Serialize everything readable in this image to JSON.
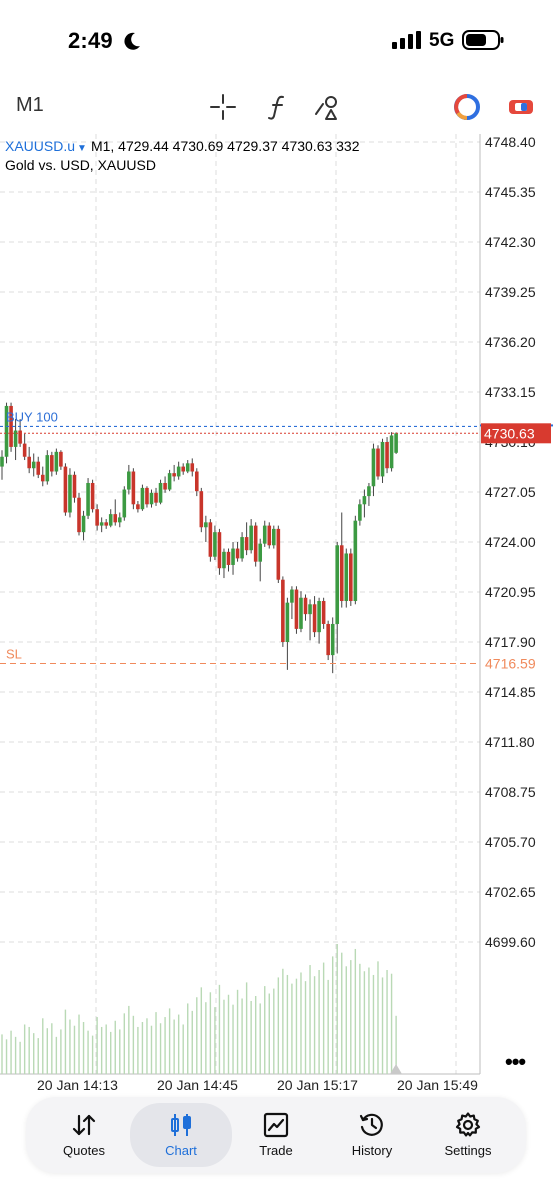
{
  "status_bar": {
    "time": "2:49",
    "network": "5G"
  },
  "toolbar": {
    "timeframe": "M1"
  },
  "chart": {
    "symbol": "XAUUSD.u",
    "ohlc_line": "M1, 4729.44 4730.69 4729.37 4730.63 332",
    "description": "Gold vs. USD, XAUUSD",
    "price_labels": [
      "4748.40",
      "4745.35",
      "4742.30",
      "4739.25",
      "4736.20",
      "4733.15",
      "4730.10",
      "4727.05",
      "4724.00",
      "4720.95",
      "4717.90",
      "4714.85",
      "4711.80",
      "4708.75",
      "4705.70",
      "4702.65",
      "4699.60"
    ],
    "time_labels": [
      "20 Jan 14:13",
      "20 Jan 14:45",
      "20 Jan 15:17",
      "20 Jan 15:49"
    ],
    "current_price": "4730.63",
    "buy_line_label": "BUY 100",
    "sl_label": "SL",
    "sl_price": "4716.59",
    "colors": {
      "bull": "#3c9a42",
      "bear": "#c8352b",
      "current": "#d83a2f",
      "buy": "#2d6fd6",
      "sl": "#f08a5c",
      "grid": "#dcdcdc",
      "volume": "#b9d9b5"
    }
  },
  "chart_data": {
    "type": "candlestick",
    "ylim": [
      4699.6,
      4748.4
    ],
    "candles": [
      [
        4728.6,
        4729.6,
        4727.8,
        4729.2
      ],
      [
        4729.2,
        4732.5,
        4728.8,
        4732.3
      ],
      [
        4732.3,
        4732.5,
        4729.5,
        4729.8
      ],
      [
        4729.8,
        4731.5,
        4729.0,
        4730.8
      ],
      [
        4730.8,
        4731.5,
        4729.8,
        4730.0
      ],
      [
        4730.0,
        4730.6,
        4729.0,
        4729.2
      ],
      [
        4729.2,
        4729.8,
        4728.2,
        4728.5
      ],
      [
        4728.5,
        4729.4,
        4728.0,
        4728.9
      ],
      [
        4728.9,
        4729.2,
        4727.9,
        4728.1
      ],
      [
        4728.1,
        4728.6,
        4727.4,
        4727.7
      ],
      [
        4727.7,
        4729.6,
        4727.5,
        4729.3
      ],
      [
        4729.3,
        4729.5,
        4728.0,
        4728.3
      ],
      [
        4728.3,
        4729.7,
        4728.1,
        4729.5
      ],
      [
        4729.5,
        4729.6,
        4728.4,
        4728.6
      ],
      [
        4728.6,
        4728.8,
        4725.6,
        4725.8
      ],
      [
        4725.8,
        4728.5,
        4725.5,
        4728.1
      ],
      [
        4728.1,
        4728.3,
        4726.4,
        4726.7
      ],
      [
        4726.7,
        4727.0,
        4724.4,
        4724.6
      ],
      [
        4724.6,
        4725.9,
        4724.1,
        4725.6
      ],
      [
        4725.6,
        4727.9,
        4725.4,
        4727.6
      ],
      [
        4727.6,
        4727.8,
        4725.8,
        4726.0
      ],
      [
        4726.0,
        4726.3,
        4724.7,
        4725.0
      ],
      [
        4725.0,
        4725.5,
        4724.6,
        4725.2
      ],
      [
        4725.2,
        4725.4,
        4724.8,
        4725.0
      ],
      [
        4725.0,
        4726.0,
        4724.9,
        4725.7
      ],
      [
        4725.7,
        4726.6,
        4725.0,
        4725.2
      ],
      [
        4725.2,
        4725.8,
        4724.9,
        4725.5
      ],
      [
        4725.5,
        4727.4,
        4725.3,
        4727.2
      ],
      [
        4727.2,
        4728.7,
        4726.9,
        4728.3
      ],
      [
        4728.3,
        4728.5,
        4726.0,
        4726.3
      ],
      [
        4726.3,
        4726.5,
        4725.8,
        4726.0
      ],
      [
        4726.0,
        4727.5,
        4725.9,
        4727.3
      ],
      [
        4727.3,
        4727.4,
        4726.1,
        4726.3
      ],
      [
        4726.3,
        4727.2,
        4726.1,
        4727.0
      ],
      [
        4727.0,
        4727.3,
        4726.2,
        4726.4
      ],
      [
        4726.4,
        4727.8,
        4726.3,
        4727.6
      ],
      [
        4727.6,
        4728.0,
        4727.0,
        4727.2
      ],
      [
        4727.2,
        4728.4,
        4727.1,
        4728.2
      ],
      [
        4728.2,
        4728.7,
        4727.7,
        4728.0
      ],
      [
        4728.0,
        4728.9,
        4727.8,
        4728.6
      ],
      [
        4728.6,
        4728.8,
        4728.1,
        4728.3
      ],
      [
        4728.3,
        4729.0,
        4728.2,
        4728.8
      ],
      [
        4728.8,
        4729.1,
        4728.0,
        4728.3
      ],
      [
        4728.3,
        4728.5,
        4726.8,
        4727.1
      ],
      [
        4727.1,
        4727.3,
        4724.6,
        4724.9
      ],
      [
        4724.9,
        4725.6,
        4724.0,
        4725.2
      ],
      [
        4725.2,
        4725.4,
        4722.8,
        4723.1
      ],
      [
        4723.1,
        4725.0,
        4722.9,
        4724.6
      ],
      [
        4724.6,
        4724.8,
        4722.0,
        4722.4
      ],
      [
        4722.4,
        4723.6,
        4721.8,
        4723.4
      ],
      [
        4723.4,
        4723.6,
        4722.2,
        4722.6
      ],
      [
        4722.6,
        4724.0,
        4722.0,
        4723.6
      ],
      [
        4723.6,
        4724.0,
        4722.8,
        4723.0
      ],
      [
        4723.0,
        4724.6,
        4722.8,
        4724.3
      ],
      [
        4724.3,
        4725.2,
        4723.2,
        4723.5
      ],
      [
        4723.5,
        4725.4,
        4723.3,
        4725.0
      ],
      [
        4725.0,
        4725.2,
        4722.5,
        4722.8
      ],
      [
        4722.8,
        4724.2,
        4721.6,
        4723.9
      ],
      [
        4723.9,
        4725.3,
        4723.7,
        4725.0
      ],
      [
        4725.0,
        4725.2,
        4723.6,
        4723.8
      ],
      [
        4723.8,
        4725.0,
        4723.6,
        4724.8
      ],
      [
        4724.8,
        4725.0,
        4721.5,
        4721.7
      ],
      [
        4721.7,
        4721.9,
        4717.6,
        4717.9
      ],
      [
        4717.9,
        4720.6,
        4716.2,
        4720.3
      ],
      [
        4720.3,
        4721.3,
        4719.3,
        4721.1
      ],
      [
        4721.1,
        4721.3,
        4718.4,
        4718.7
      ],
      [
        4718.7,
        4721.0,
        4718.5,
        4720.6
      ],
      [
        4720.6,
        4720.8,
        4719.2,
        4719.6
      ],
      [
        4719.6,
        4720.5,
        4718.0,
        4720.2
      ],
      [
        4720.2,
        4720.7,
        4718.2,
        4718.5
      ],
      [
        4718.5,
        4720.6,
        4717.8,
        4720.4
      ],
      [
        4720.4,
        4720.6,
        4718.7,
        4719.0
      ],
      [
        4719.0,
        4719.2,
        4716.8,
        4717.1
      ],
      [
        4717.1,
        4719.4,
        4716.0,
        4719.0
      ],
      [
        4719.0,
        4724.0,
        4717.2,
        4723.8
      ],
      [
        4723.8,
        4725.8,
        4720.0,
        4720.4
      ],
      [
        4720.4,
        4723.6,
        4720.0,
        4723.3
      ],
      [
        4723.3,
        4723.6,
        4720.1,
        4720.4
      ],
      [
        4720.4,
        4725.6,
        4720.2,
        4725.3
      ],
      [
        4725.3,
        4726.6,
        4725.0,
        4726.3
      ],
      [
        4726.3,
        4727.2,
        4725.5,
        4726.8
      ],
      [
        4726.8,
        4727.6,
        4726.2,
        4727.4
      ],
      [
        4727.4,
        4730.0,
        4726.8,
        4729.7
      ],
      [
        4729.7,
        4729.9,
        4727.8,
        4728.0
      ],
      [
        4728.0,
        4730.3,
        4727.6,
        4730.1
      ],
      [
        4730.1,
        4730.4,
        4728.2,
        4728.5
      ],
      [
        4728.5,
        4730.7,
        4728.3,
        4730.5
      ],
      [
        4729.44,
        4730.69,
        4729.37,
        4730.63
      ]
    ],
    "volume": [
      32,
      28,
      35,
      30,
      26,
      40,
      38,
      33,
      29,
      45,
      37,
      41,
      30,
      36,
      52,
      44,
      39,
      48,
      42,
      35,
      31,
      46,
      38,
      40,
      34,
      43,
      36,
      49,
      55,
      47,
      38,
      42,
      45,
      39,
      50,
      41,
      46,
      53,
      44,
      48,
      40,
      57,
      51,
      62,
      70,
      58,
      66,
      54,
      72,
      60,
      64,
      56,
      68,
      61,
      74,
      59,
      63,
      57,
      71,
      65,
      69,
      78,
      85,
      80,
      73,
      77,
      82,
      75,
      88,
      79,
      84,
      90,
      76,
      95,
      105,
      98,
      87,
      92,
      101,
      89,
      83,
      86,
      80,
      91,
      78,
      84,
      81,
      47
    ]
  },
  "tabs": [
    {
      "label": "Quotes",
      "icon": "quotes-arrows-icon"
    },
    {
      "label": "Chart",
      "icon": "candlestick-icon"
    },
    {
      "label": "Trade",
      "icon": "trade-chart-icon"
    },
    {
      "label": "History",
      "icon": "history-clock-icon"
    },
    {
      "label": "Settings",
      "icon": "gear-icon"
    }
  ]
}
